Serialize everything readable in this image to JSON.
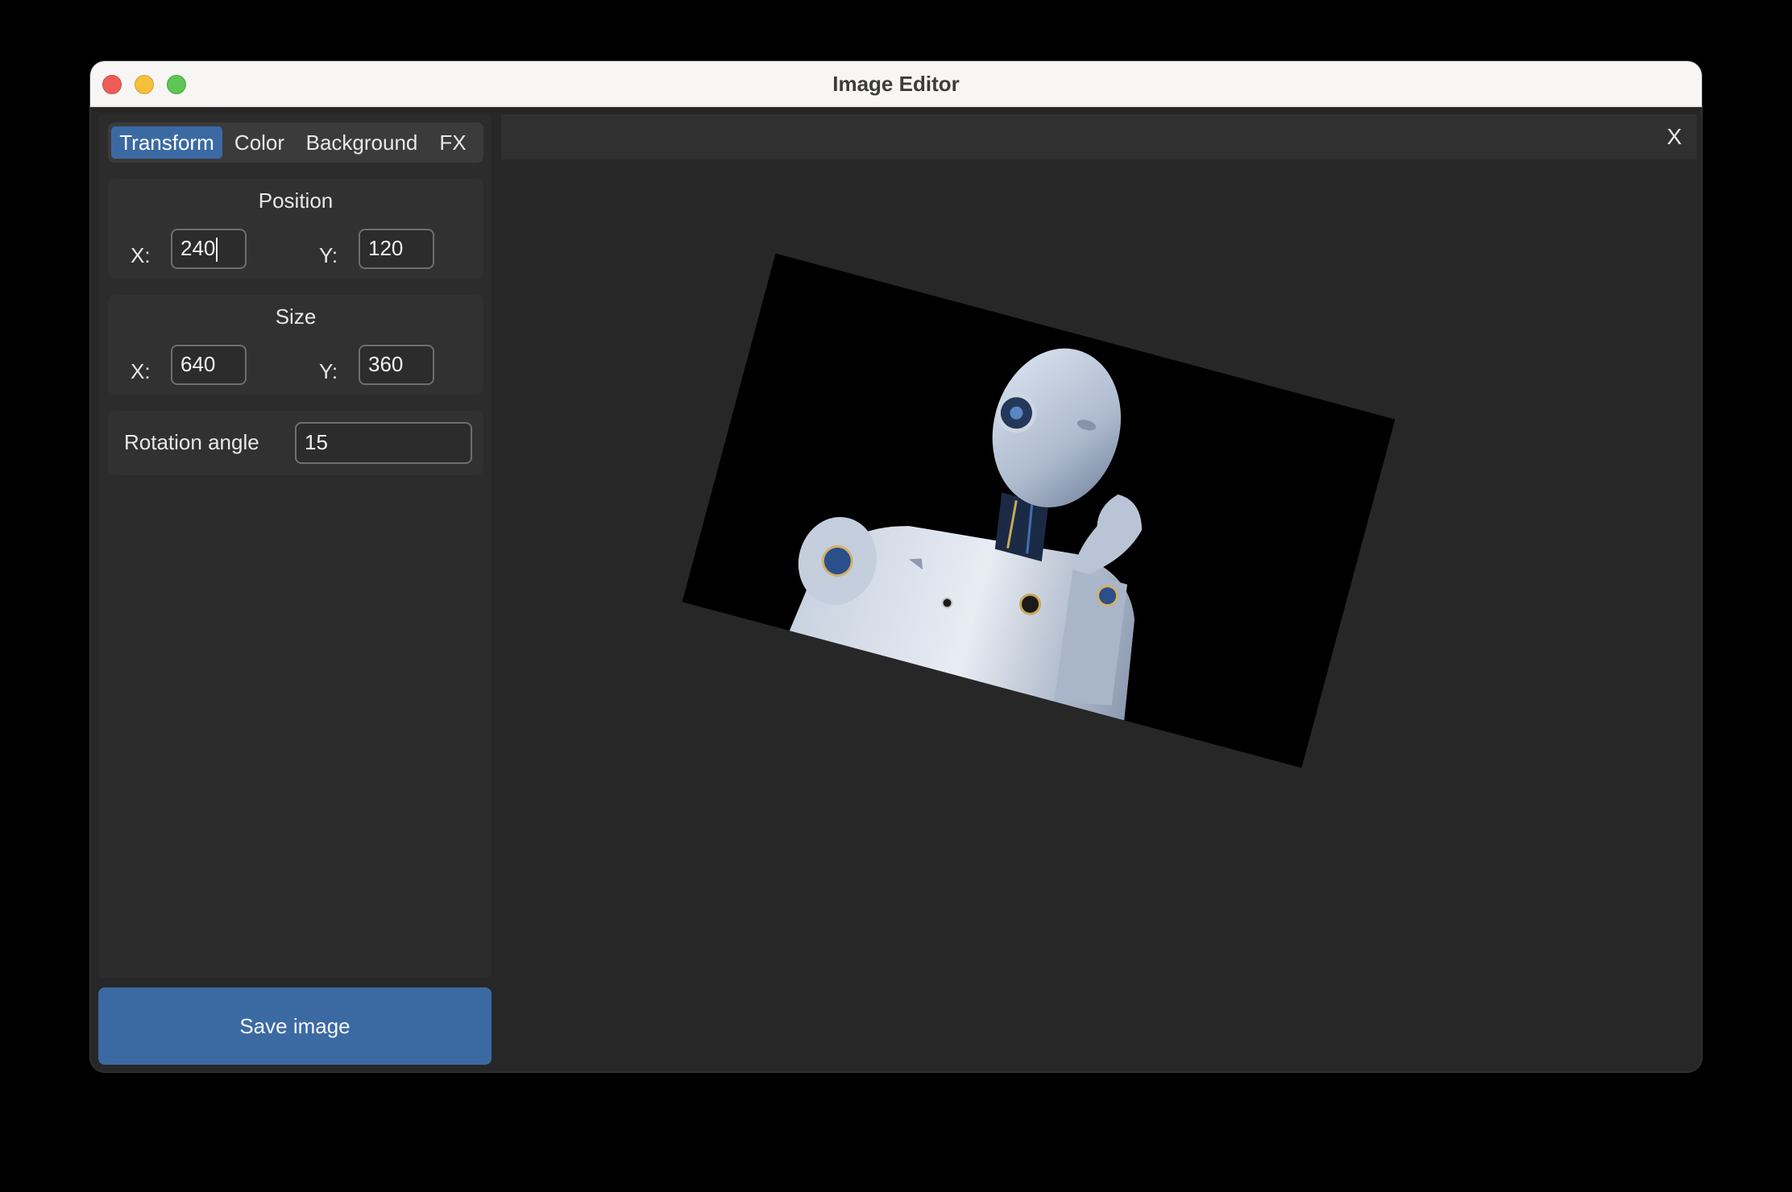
{
  "window": {
    "title": "Image Editor"
  },
  "tabs": [
    {
      "label": "Transform",
      "active": true
    },
    {
      "label": "Color",
      "active": false
    },
    {
      "label": "Background",
      "active": false
    },
    {
      "label": "FX",
      "active": false
    }
  ],
  "position": {
    "title": "Position",
    "x_label": "X:",
    "x_value": "240",
    "y_label": "Y:",
    "y_value": "120"
  },
  "size": {
    "title": "Size",
    "x_label": "X:",
    "x_value": "640",
    "y_label": "Y:",
    "y_value": "360"
  },
  "rotation": {
    "label": "Rotation angle",
    "value": "15"
  },
  "actions": {
    "save_label": "Save image",
    "close_label": "X"
  },
  "colors": {
    "accent": "#3b6aa3",
    "close": "#ee5d55",
    "minimize": "#f5be3b",
    "maximize": "#5fc553"
  },
  "icons": {
    "preview_subject": "robot-bust-image"
  }
}
